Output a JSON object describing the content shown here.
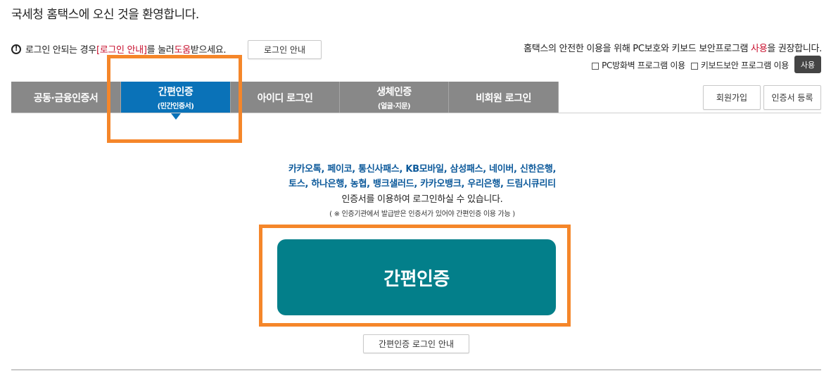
{
  "header": {
    "welcome": "국세청 홈택스에 오신 것을 환영합니다."
  },
  "help": {
    "icon": "alert-circle-icon",
    "text_before": "로그인 안되는 경우 ",
    "link_text": "[로그인 안내]",
    "text_middle": "를 눌러 ",
    "red_word": "도움",
    "text_after": "받으세요.",
    "button_label": "로그인 안내"
  },
  "security": {
    "text_before": "홈택스의 안전한 이용을 위해 PC보호와 키보드 보안프로그램 ",
    "red_word": "사용",
    "text_after": "을 권장합니다.",
    "checkbox1_label": "PC방화벽 프로그램 이용",
    "checkbox2_label": "키보드보안 프로그램 이용",
    "use_button": "사용"
  },
  "tabs": [
    {
      "label": "공동·금융인증서",
      "sub": ""
    },
    {
      "label": "간편인증",
      "sub": "(민간인증서)"
    },
    {
      "label": "아이디 로그인",
      "sub": ""
    },
    {
      "label": "생체인증",
      "sub": "(얼굴·지문)"
    },
    {
      "label": "비회원 로그인",
      "sub": ""
    }
  ],
  "active_tab_index": 1,
  "right_buttons": {
    "signup": "회원가입",
    "cert_register": "인증서 등록"
  },
  "content": {
    "providers_line1": "카카오톡, 페이코, 통신사패스, KB모바일, 삼성패스, 네이버, 신한은행,",
    "providers_line2": "토스, 하나은행, 농협, 뱅크샐러드, 카카오뱅크, 우리은행, 드림시큐리티",
    "available_text": "인증서를 이용하여 로그인하실 수 있습니다.",
    "note": "( ※ 인증기관에서 발급받은 인증서가 있어야 간편인증 이용 가능 )",
    "main_button": "간편인증",
    "guide_button": "간편인증 로그인 안내"
  },
  "colors": {
    "active_tab": "#0a72b8",
    "inactive_tab": "#888888",
    "main_button": "#037f8a",
    "highlight": "#f5862a",
    "provider_text": "#0d5a9b",
    "accent_red": "#c8102e"
  }
}
